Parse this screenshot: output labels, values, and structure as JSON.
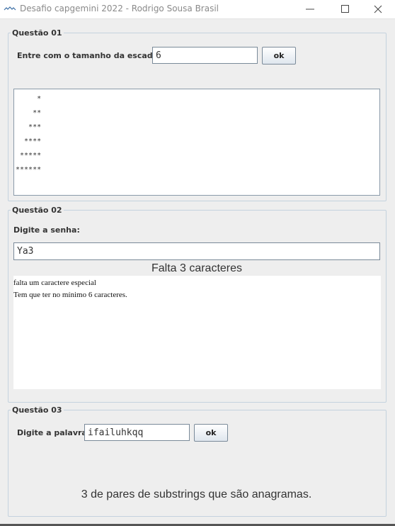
{
  "window": {
    "title": "Desafio capgemini 2022 - Rodrigo Sousa Brasil",
    "icon": "java-app-icon"
  },
  "q1": {
    "group_title": "Questão 01",
    "size_label": "Entre com o tamanho da escada:",
    "size_value": "6",
    "ok_label": "ok",
    "stairs": "     *\n    **\n   ***\n  ****\n *****\n******"
  },
  "q2": {
    "group_title": "Questão 02",
    "password_label": "Digite a senha:",
    "password_value": "Ya3",
    "missing_text": "Falta 3 caracteres",
    "messages": [
      "falta um caractere especial",
      "Tem que ter no mínimo 6 caracteres."
    ]
  },
  "q3": {
    "group_title": "Questão 03",
    "word_label": "Digite a palavra:",
    "word_value": "ifailuhkqq",
    "ok_label": "ok",
    "result_text": "3 de pares de substrings que são anagramas."
  }
}
